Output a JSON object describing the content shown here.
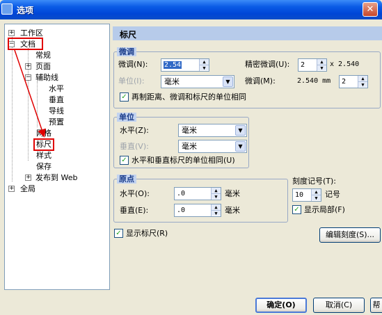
{
  "window": {
    "title": "选项",
    "close_glyph": "✕"
  },
  "tree": {
    "items": [
      {
        "label": "工作区",
        "expander": "+"
      },
      {
        "label": "文档",
        "expander": "−"
      },
      {
        "label": "常规"
      },
      {
        "label": "页面",
        "expander": "+"
      },
      {
        "label": "辅助线",
        "expander": "−"
      },
      {
        "label": "水平"
      },
      {
        "label": "垂直"
      },
      {
        "label": "导线"
      },
      {
        "label": "预置"
      },
      {
        "label": "网格"
      },
      {
        "label": "标尺"
      },
      {
        "label": "样式"
      },
      {
        "label": "保存"
      },
      {
        "label": "发布到 Web",
        "expander": "+"
      },
      {
        "label": "全局",
        "expander": "+"
      }
    ]
  },
  "panel": {
    "header": "标尺",
    "nudge": {
      "title": "微调",
      "nudge_label": "微调(N):",
      "nudge_value": "2.54",
      "unit_label": "单位(I):",
      "unit_value": "毫米",
      "precise_label": "精密微调(U):",
      "precise_value": "2",
      "precise_suffix": "x 2.540",
      "micro_label": "微调(M):",
      "micro_value_text": "2.540 mm",
      "micro_value": "2",
      "sync_checkbox": "再制距离、微调和标尺的单位相同"
    },
    "units": {
      "title": "单位",
      "horizontal_label": "水平(Z):",
      "horizontal_value": "毫米",
      "vertical_label": "垂直(V):",
      "vertical_value": "毫米",
      "same_checkbox": "水平和垂直标尺的单位相同(U)"
    },
    "origin": {
      "title": "原点",
      "horizontal_label": "水平(O):",
      "horizontal_value": ".0",
      "horizontal_unit": "毫米",
      "vertical_label": "垂直(E):",
      "vertical_value": ".0",
      "vertical_unit": "毫米"
    },
    "ticks": {
      "label": "刻度记号(T):",
      "value": "10",
      "unit": "记号",
      "show_fraction_checkbox": "显示局部(F)"
    },
    "show_rulers_checkbox": "显示标尺(R)",
    "edit_scale_button": "编辑刻度(S)..."
  },
  "footer": {
    "ok": "确定(O)",
    "cancel": "取消(C)",
    "help": "帮"
  },
  "colors": {
    "highlight_box": "#E00000",
    "header_bg": "#B7CBEA"
  }
}
